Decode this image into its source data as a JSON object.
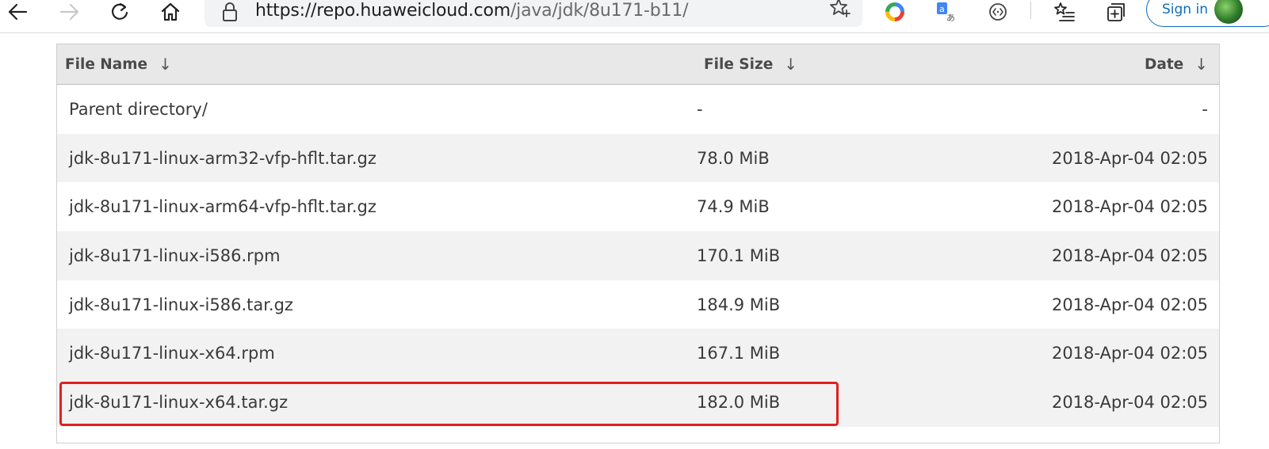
{
  "browser": {
    "url_host": "https://repo.huaweicloud.com",
    "url_path": "/java/jdk/8u171-b11/",
    "signin_label": "Sign in",
    "icons": [
      "back-icon",
      "forward-icon",
      "refresh-icon",
      "home-icon",
      "lock-icon",
      "favorite-star-icon",
      "extension-ring-icon",
      "translate-icon",
      "code-extension-icon",
      "favorites-list-icon",
      "collections-icon"
    ]
  },
  "listing": {
    "headers": {
      "name": "File Name",
      "size": "File Size",
      "date": "Date",
      "sort_arrow": "↓"
    },
    "rows": [
      {
        "name": "Parent directory/",
        "size": "-",
        "date": "-"
      },
      {
        "name": "jdk-8u171-linux-arm32-vfp-hflt.tar.gz",
        "size": "78.0 MiB",
        "date": "2018-Apr-04 02:05"
      },
      {
        "name": "jdk-8u171-linux-arm64-vfp-hflt.tar.gz",
        "size": "74.9 MiB",
        "date": "2018-Apr-04 02:05"
      },
      {
        "name": "jdk-8u171-linux-i586.rpm",
        "size": "170.1 MiB",
        "date": "2018-Apr-04 02:05"
      },
      {
        "name": "jdk-8u171-linux-i586.tar.gz",
        "size": "184.9 MiB",
        "date": "2018-Apr-04 02:05"
      },
      {
        "name": "jdk-8u171-linux-x64.rpm",
        "size": "167.1 MiB",
        "date": "2018-Apr-04 02:05"
      },
      {
        "name": "jdk-8u171-linux-x64.tar.gz",
        "size": "182.0 MiB",
        "date": "2018-Apr-04 02:05"
      }
    ]
  },
  "colors": {
    "highlight_box": "#e02020",
    "signin_accent": "#0f6cbd"
  }
}
